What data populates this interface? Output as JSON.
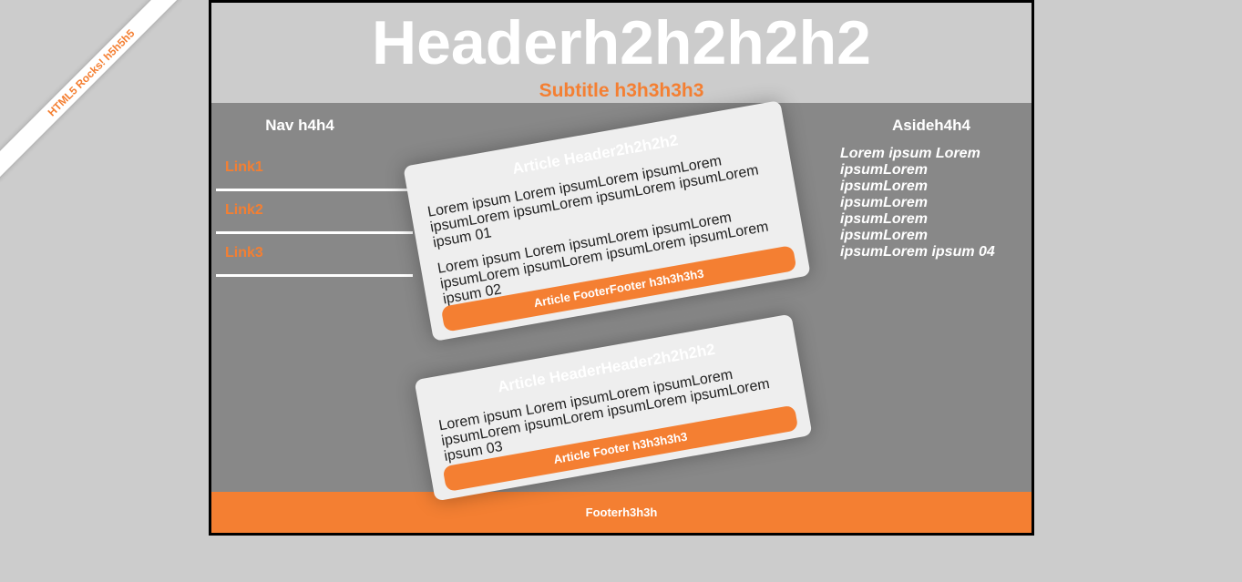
{
  "ribbon": {
    "text": "HTML5 Rocks! h5h5h5"
  },
  "header": {
    "title": "Headerh2h2h2h2",
    "subtitle": "Subtitle h3h3h3h3"
  },
  "nav": {
    "title": "Nav h4h4",
    "items": [
      {
        "label": "Link1"
      },
      {
        "label": "Link2"
      },
      {
        "label": "Link3"
      }
    ]
  },
  "articles": [
    {
      "header": "Article Header2h2h2h2",
      "paragraphs": [
        "Lorem ipsum Lorem ipsumLorem ipsumLorem ipsumLorem ipsumLorem ipsumLorem ipsumLorem ipsum 01",
        "Lorem ipsum Lorem ipsumLorem ipsumLorem ipsumLorem ipsumLorem ipsumLorem ipsumLorem ipsum 02"
      ],
      "footer": "Article FooterFooter h3h3h3h3"
    },
    {
      "header": "Article HeaderHeader2h2h2h2",
      "paragraphs": [
        "Lorem ipsum Lorem ipsumLorem ipsumLorem ipsumLorem ipsumLorem ipsumLorem ipsumLorem ipsum 03"
      ],
      "footer": "Article Footer h3h3h3h3"
    }
  ],
  "aside": {
    "title": "Asideh4h4",
    "text": "Lorem ipsum Lorem\nipsumLorem\nipsumLorem\nipsumLorem\nipsumLorem\nipsumLorem\nipsumLorem ipsum 04"
  },
  "footer": {
    "text": "Footerh3h3h"
  },
  "colors": {
    "accent": "#f47f32",
    "page_background": "#cccccc",
    "content_background": "#888888",
    "article_background": "#eeeeee"
  }
}
